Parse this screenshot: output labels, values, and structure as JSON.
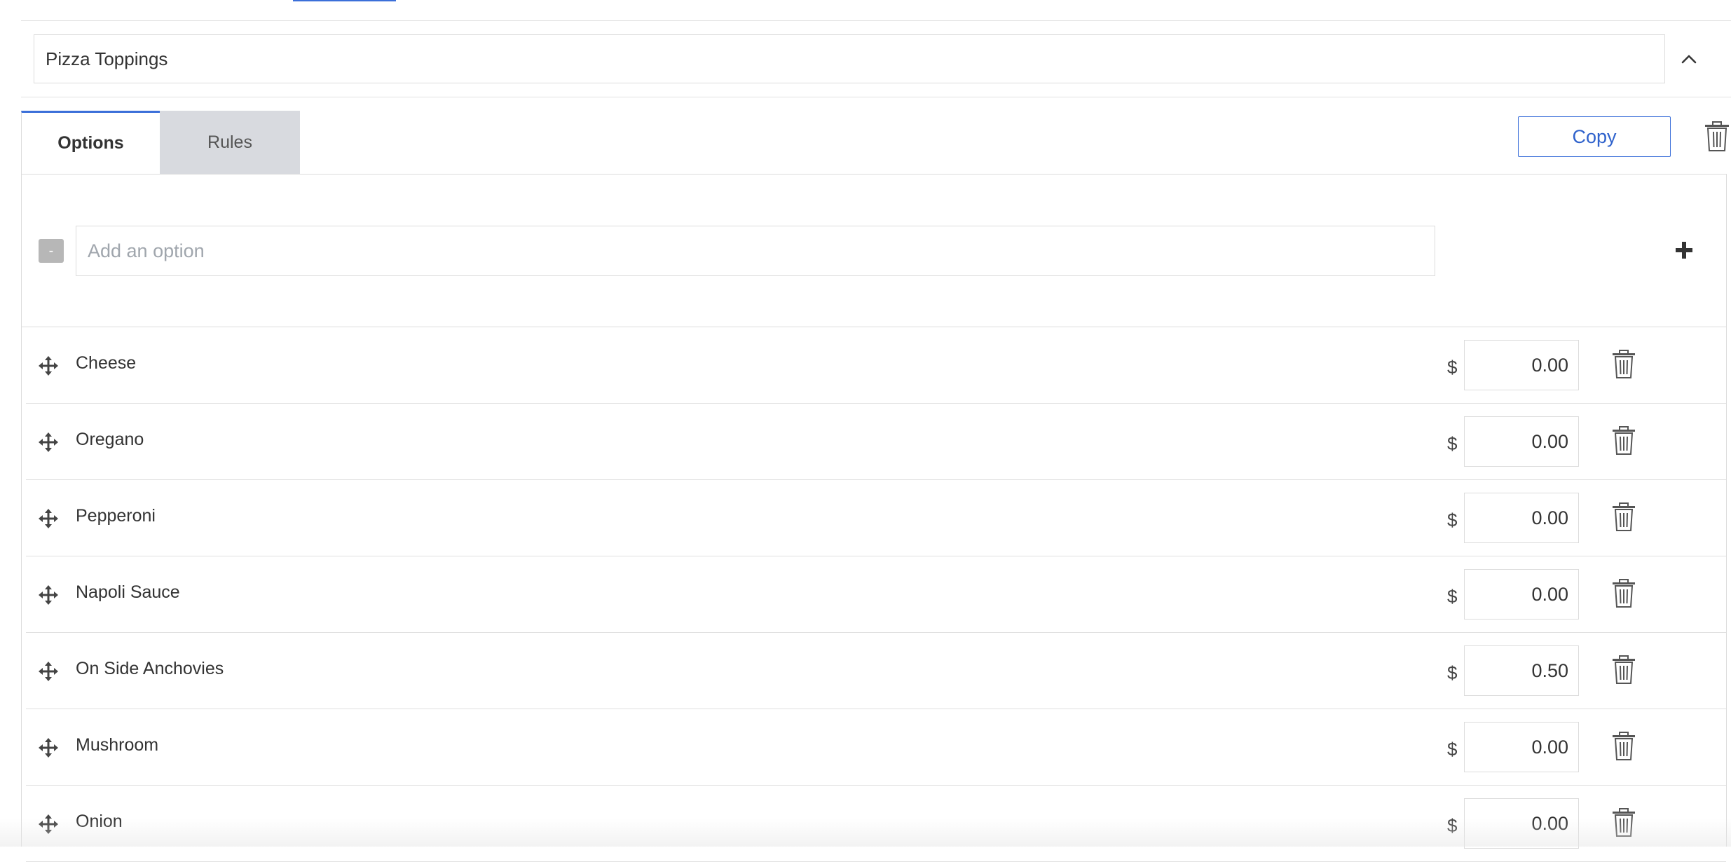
{
  "group": {
    "name": "Pizza Toppings"
  },
  "tabs": {
    "options_label": "Options",
    "rules_label": "Rules"
  },
  "toolbar": {
    "copy_label": "Copy"
  },
  "add_option": {
    "handle_glyph": "-",
    "placeholder": "Add an option",
    "value": ""
  },
  "currency_symbol": "$",
  "options": [
    {
      "name": "Cheese",
      "price": "0.00"
    },
    {
      "name": "Oregano",
      "price": "0.00"
    },
    {
      "name": "Pepperoni",
      "price": "0.00"
    },
    {
      "name": "Napoli Sauce",
      "price": "0.00"
    },
    {
      "name": "On Side Anchovies",
      "price": "0.50"
    },
    {
      "name": "Mushroom",
      "price": "0.00"
    },
    {
      "name": "Onion",
      "price": "0.00"
    }
  ],
  "icons": {
    "collapse": "chevron-up-icon",
    "delete": "trash-icon",
    "add": "plus-icon",
    "drag": "move-icon"
  },
  "colors": {
    "accent": "#3b6fd9",
    "tab_inactive_bg": "#d8dadf"
  }
}
